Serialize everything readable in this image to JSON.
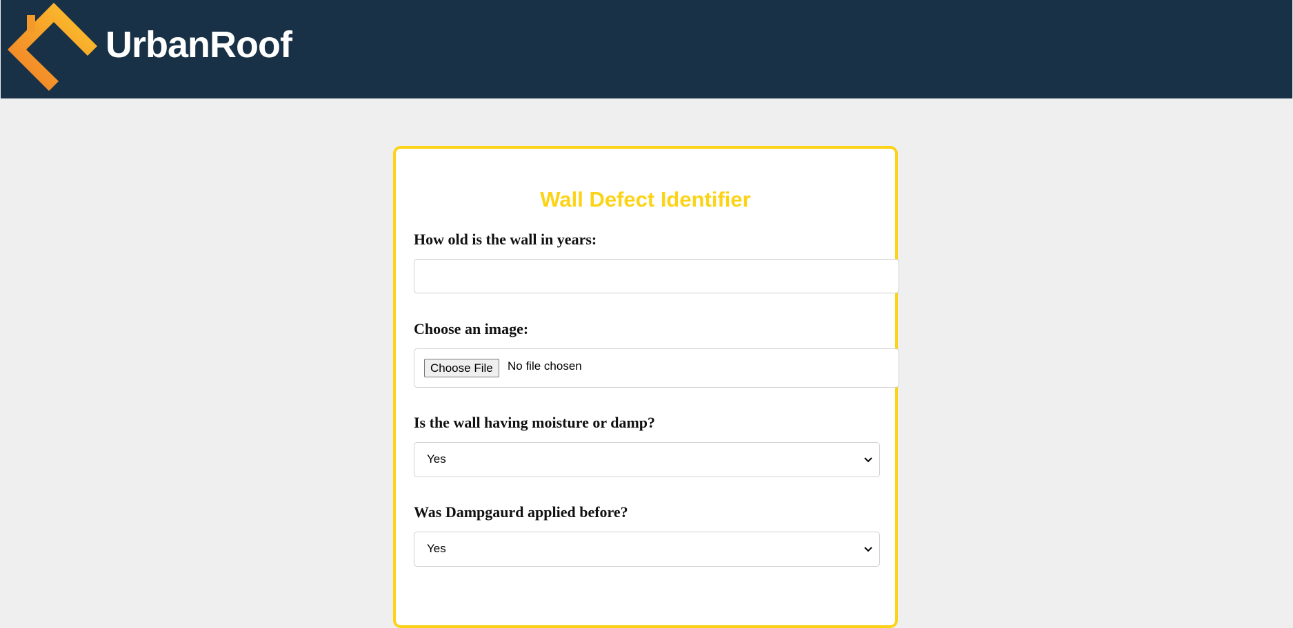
{
  "header": {
    "brand": "UrbanRoof",
    "logo_icon": "house-diamond-logo-icon",
    "background_color": "#183146",
    "accent_color": "#fcd316"
  },
  "form": {
    "title": "Wall Defect Identifier",
    "age": {
      "label": "How old is the wall in years:",
      "value": ""
    },
    "image": {
      "label": "Choose an image:",
      "button_label": "Choose File",
      "status": "No file chosen"
    },
    "moisture": {
      "label": "Is the wall having moisture or damp?",
      "selected": "Yes",
      "icon": "chevron-down-icon"
    },
    "dampguard": {
      "label": "Was Dampgaurd applied before?",
      "selected": "Yes",
      "icon": "chevron-down-icon"
    }
  }
}
